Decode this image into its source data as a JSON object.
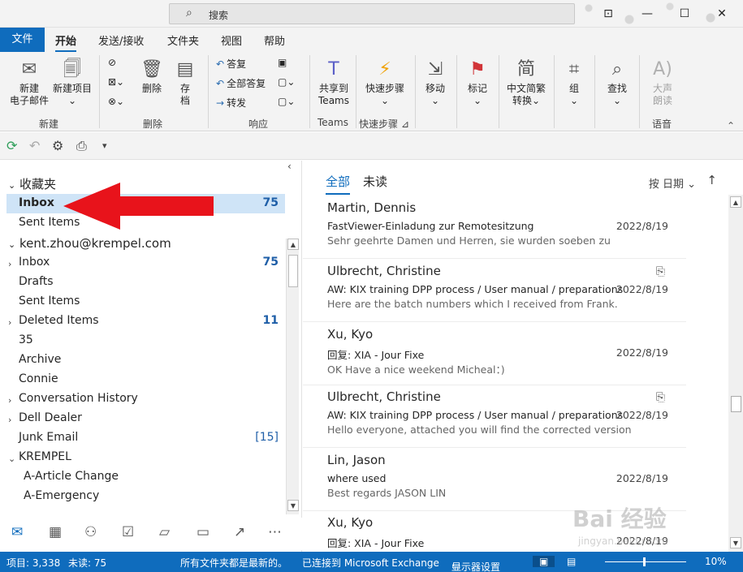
{
  "titlebar": {
    "search_placeholder": "搜索"
  },
  "ribbon_tabs": [
    "文件",
    "开始",
    "发送/接收",
    "文件夹",
    "视图",
    "帮助"
  ],
  "ribbon": {
    "new_email": "新建\n电子邮件",
    "new_email_l1": "新建",
    "new_email_l2": "电子邮件",
    "new_item_l1": "新建项目",
    "group_new": "新建",
    "delete": "删除",
    "archive_l1": "存",
    "archive_l2": "档",
    "group_delete": "删除",
    "reply": "答复",
    "reply_all": "全部答复",
    "forward": "转发",
    "group_respond": "响应",
    "teams_l1": "共享到",
    "teams_l2": "Teams",
    "group_teams": "Teams",
    "quick_steps": "快速步骤",
    "group_quick_steps": "快速步骤",
    "move": "移动",
    "tags": "标记",
    "convert_l1": "中文简繁",
    "convert_l2": "转换",
    "group": "组",
    "find": "查找",
    "read_aloud_l1": "大声",
    "read_aloud_l2": "朗读",
    "group_speech": "语音"
  },
  "favorites": {
    "header": "收藏夹",
    "items": [
      {
        "label": "Inbox",
        "count": "75"
      },
      {
        "label": "Sent Items",
        "count": ""
      }
    ]
  },
  "account": {
    "header": "kent.zhou@krempel.com",
    "folders": [
      {
        "label": "Inbox",
        "count": "75",
        "chevron": true
      },
      {
        "label": "Drafts",
        "count": "",
        "chevron": false
      },
      {
        "label": "Sent Items",
        "count": "",
        "chevron": false
      },
      {
        "label": "Deleted Items",
        "count": "11",
        "chevron": true
      },
      {
        "label": "35",
        "count": "",
        "chevron": false
      },
      {
        "label": "Archive",
        "count": "",
        "chevron": false
      },
      {
        "label": "Connie",
        "count": "",
        "chevron": false
      },
      {
        "label": "Conversation History",
        "count": "",
        "chevron": true
      },
      {
        "label": "Dell Dealer",
        "count": "",
        "chevron": true
      },
      {
        "label": "Junk Email",
        "count": "[15]",
        "chevron": false
      },
      {
        "label": "KREMPEL",
        "count": "",
        "chevron": true
      },
      {
        "label": "A-Article Change",
        "count": "",
        "chevron": false
      },
      {
        "label": "A-Emergency",
        "count": "",
        "chevron": false
      }
    ]
  },
  "message_list": {
    "tab_all": "全部",
    "tab_unread": "未读",
    "sort_label": "按 日期",
    "messages": [
      {
        "from": "Martin, Dennis",
        "subject": "FastViewer-Einladung zur Remotesitzung",
        "preview": "Sehr geehrte Damen und Herren,   sie wurden soeben zu",
        "date": "2022/8/19",
        "attachment": false
      },
      {
        "from": "Ulbrecht, Christine",
        "subject": "AW: KIX training DPP process / User manual / preparations",
        "preview": "Here are the batch numbers which I received from Frank.",
        "date": "2022/8/19",
        "attachment": true
      },
      {
        "from": "Xu, Kyo",
        "subject": "回复: XIA - Jour Fixe",
        "preview": "OK  Have a nice weekend  Micheal：)",
        "date": "2022/8/19",
        "attachment": false
      },
      {
        "from": "Ulbrecht, Christine",
        "subject": "AW: KIX training DPP process / User manual / preparations",
        "preview": "Hello everyone,  attached you will find the corrected version",
        "date": "2022/8/19",
        "attachment": true
      },
      {
        "from": "Lin, Jason",
        "subject": "where used",
        "preview": "Best regards    JASON LIN",
        "date": "2022/8/19",
        "attachment": false
      },
      {
        "from": "Xu, Kyo",
        "subject": "回复: XIA - Jour Fixe",
        "preview": "",
        "date": "2022/8/19",
        "attachment": false
      }
    ]
  },
  "statusbar": {
    "items": "项目: 3,338",
    "unread": "未读: 75",
    "sync": "所有文件夹都是最新的。",
    "connected": "已连接到 Microsoft Exchange",
    "display": "显示器设置",
    "zoom": "10%"
  },
  "watermark": {
    "text": "Bai 经验",
    "url": "jingyan.baidu.com"
  },
  "colors": {
    "accent": "#0f6cbd",
    "selection": "#cfe4f7",
    "arrow": "#e8131b",
    "count": "#1f5fa8"
  }
}
